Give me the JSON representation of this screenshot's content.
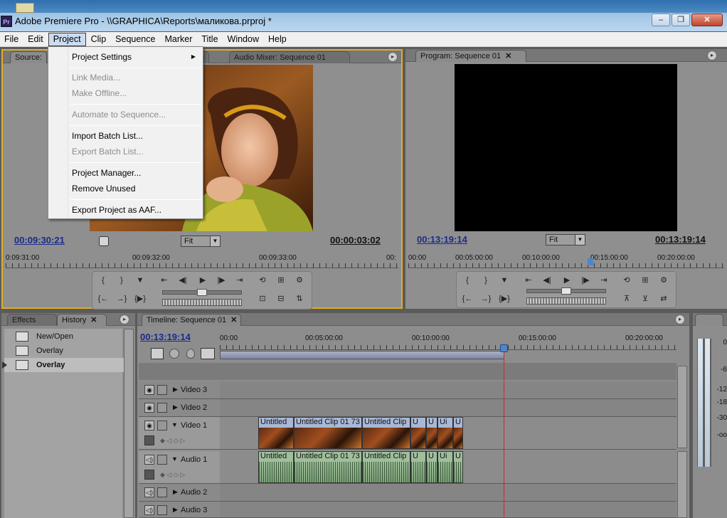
{
  "window": {
    "title": "Adobe Premiere Pro - \\\\GRAPHICA\\Reports\\маликова.prproj *",
    "app_icon": "Pr",
    "buttons": [
      "‒",
      "❐",
      "✕"
    ]
  },
  "menubar": {
    "items": [
      "File",
      "Edit",
      "Project",
      "Clip",
      "Sequence",
      "Marker",
      "Title",
      "Window",
      "Help"
    ],
    "active": "Project"
  },
  "project_menu": {
    "items": [
      {
        "label": "Project Settings",
        "enabled": true,
        "submenu": true
      },
      {
        "label": "Link Media...",
        "enabled": false
      },
      {
        "label": "Make Offline...",
        "enabled": false
      },
      {
        "label": "Automate to Sequence...",
        "enabled": false
      },
      {
        "label": "Import Batch List...",
        "enabled": true
      },
      {
        "label": "Export Batch List...",
        "enabled": false
      },
      {
        "label": "Project Manager...",
        "enabled": true
      },
      {
        "label": "Remove Unused",
        "enabled": true
      },
      {
        "label": "Export Project as AAF...",
        "enabled": true
      }
    ]
  },
  "source_monitor": {
    "tabs": [
      "Source:",
      "ls",
      "Audio Mixer: Sequence 01"
    ],
    "timecode_current": "00:09:30:21",
    "timecode_duration": "00:00:03:02",
    "zoom": "Fit",
    "ruler": [
      "0:09:31:00",
      "00:09:32:00",
      "00:09:33:00",
      "00:"
    ]
  },
  "program_monitor": {
    "tab": "Program: Sequence 01",
    "timecode_current": "00:13:19:14",
    "timecode_duration": "00:13:19:14",
    "zoom": "Fit",
    "ruler": [
      "00:00",
      "00:05:00:00",
      "00:10:00:00",
      "00:15:00:00",
      "00:20:00:00"
    ]
  },
  "history": {
    "tabs": [
      "Effects",
      "History"
    ],
    "items": [
      "New/Open",
      "Overlay",
      "Overlay"
    ],
    "selected_index": 2
  },
  "timeline": {
    "tab": "Timeline: Sequence 01",
    "timecode": "00:13:19:14",
    "ruler": [
      "00:00",
      "00:05:00:00",
      "00:10:00:00",
      "00:15:00:00",
      "00:20:00:00"
    ],
    "video_tracks": [
      "Video 3",
      "Video 2",
      "Video 1"
    ],
    "audio_tracks": [
      "Audio 1",
      "Audio 2",
      "Audio 3"
    ],
    "clips": [
      "Untitled",
      "Untitled Clip 01 73",
      "Untitled Clip",
      "U",
      "U",
      "Ui",
      "U"
    ]
  },
  "audio_meter": {
    "labels": [
      "0",
      "-6",
      "-12",
      "-18",
      "-30",
      "-oo"
    ]
  },
  "icons": {
    "panel_menu": "panel-menu-icon",
    "eye": "eye-icon",
    "speaker": "speaker-icon",
    "play": "play-icon"
  }
}
